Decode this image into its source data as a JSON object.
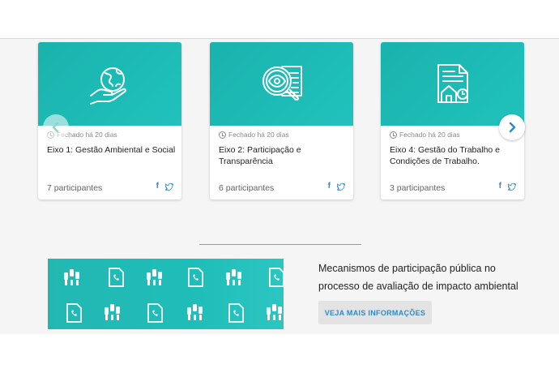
{
  "cards": [
    {
      "status": "Fechado há 20 dias",
      "title": "Eixo 1: Gestão Ambiental e Social",
      "participants": "7 participantes",
      "icon": "globe-hand-icon",
      "facebook": "f"
    },
    {
      "status": "Fechado há 20 dias",
      "title": "Eixo 2: Participação e Transparência",
      "participants": "6 participantes",
      "icon": "magnifier-eye-icon",
      "facebook": "f"
    },
    {
      "status": "Fechado há 20 dias",
      "title": "Eixo 4: Gestão do Trabalho e Condições de Trabalho.",
      "participants": "3 participantes",
      "icon": "document-house-icon",
      "facebook": "f"
    }
  ],
  "info": {
    "text": "Mecanismos de participação pública no processo de avaliação de impacto ambiental",
    "button": "VEJA MAIS INFORMAÇÕES"
  },
  "colors": {
    "teal": "#1fbab5",
    "link_blue": "#2e8bc9",
    "background": "#f5f5f5"
  }
}
